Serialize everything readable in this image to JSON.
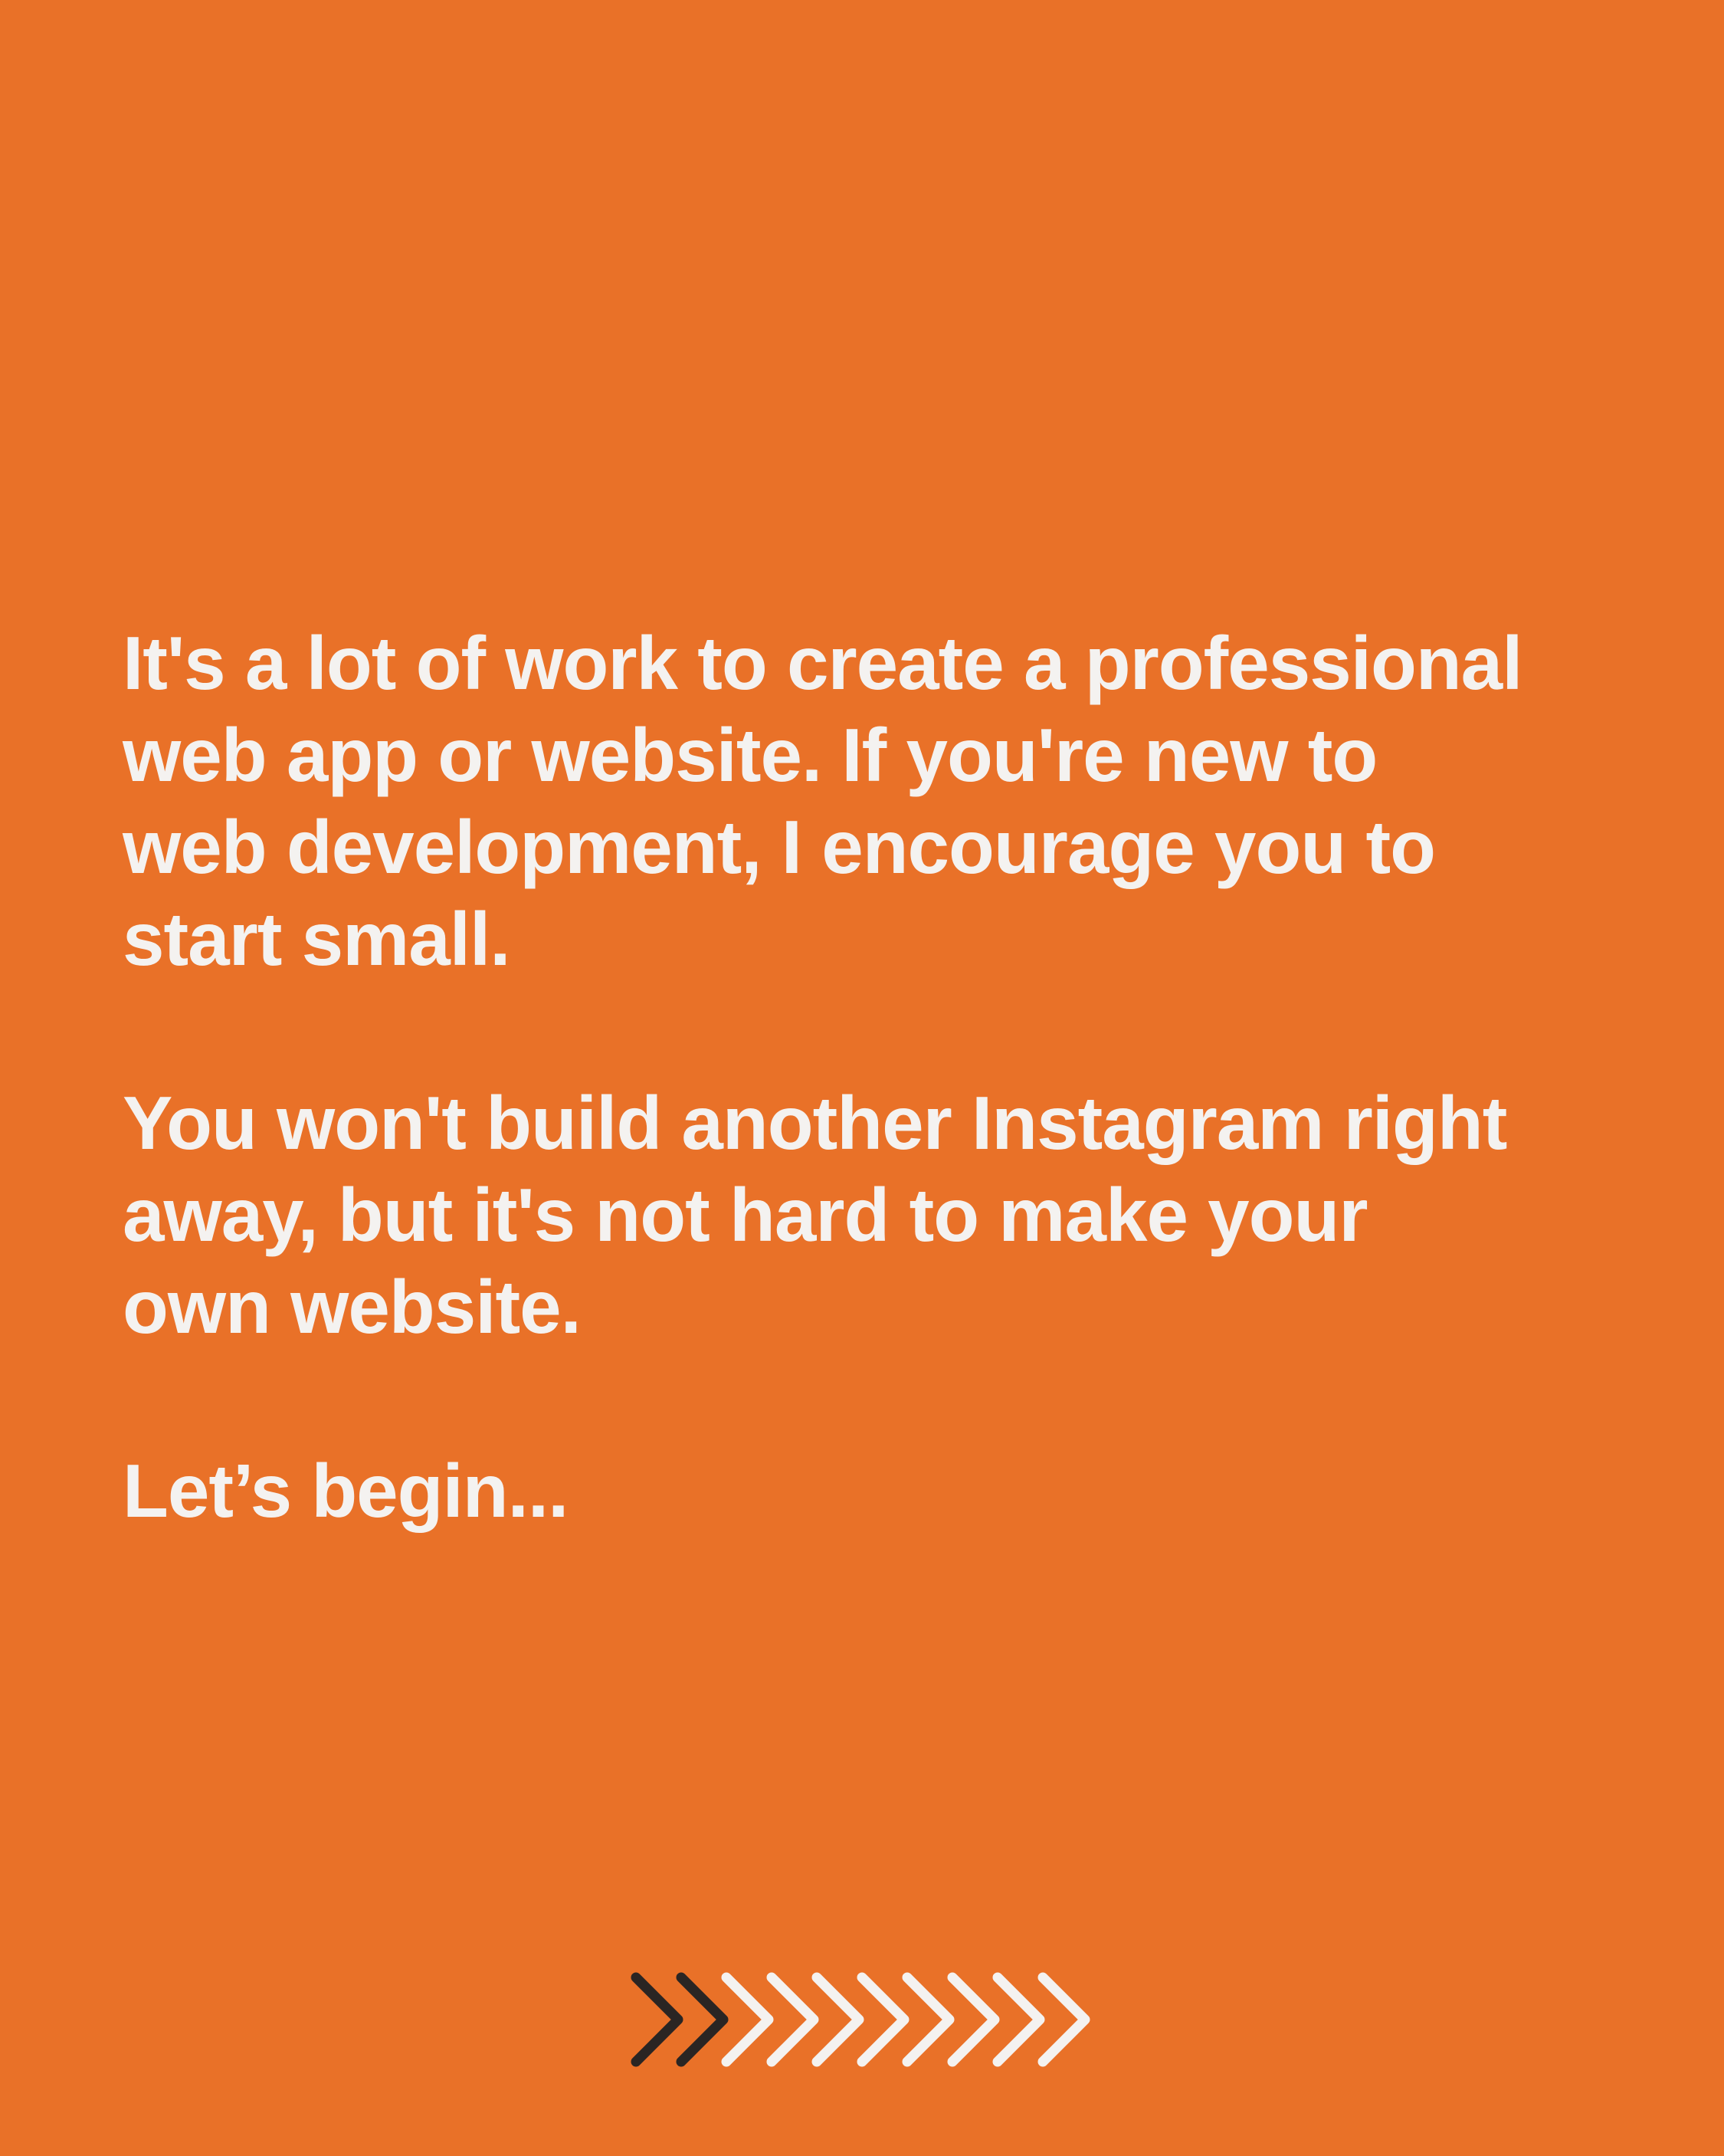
{
  "slide": {
    "paragraphs": [
      {
        "lines": [
          "It's a lot of work to create a professional",
          "web app or website. If you're new to",
          "web development, I encourage you to",
          "start small."
        ]
      },
      {
        "lines": [
          "You won't build another Instagram right",
          "away, but it's not hard to make your",
          "own website."
        ]
      },
      {
        "lines": [
          "Let’s begin..."
        ]
      }
    ],
    "next_indicator": {
      "icon": "chevrons-right-icon",
      "total": 10,
      "active": 2
    }
  },
  "colors": {
    "background": "#E97128",
    "text": "#F4F2F0",
    "chevron_active": "#2A2523",
    "chevron_inactive": "#F4F2F0"
  }
}
